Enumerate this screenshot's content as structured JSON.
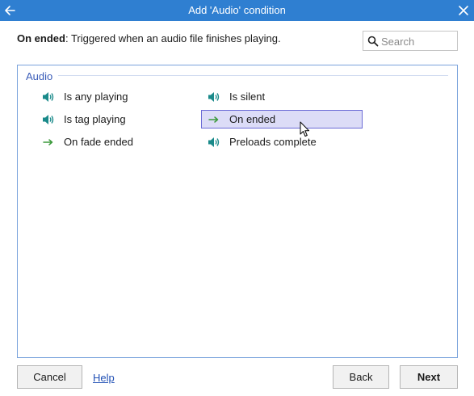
{
  "window": {
    "title": "Add 'Audio' condition"
  },
  "description": {
    "name": "On ended",
    "text": ": Triggered when an audio file finishes playing."
  },
  "search": {
    "placeholder": "Search",
    "value": ""
  },
  "group": {
    "label": "Audio",
    "items": [
      {
        "label": "Is any playing",
        "icon": "speaker-icon"
      },
      {
        "label": "Is silent",
        "icon": "speaker-icon"
      },
      {
        "label": "Is tag playing",
        "icon": "speaker-icon"
      },
      {
        "label": "On ended",
        "icon": "arrow-right-icon",
        "selected": true
      },
      {
        "label": "On fade ended",
        "icon": "arrow-right-icon"
      },
      {
        "label": "Preloads complete",
        "icon": "speaker-icon"
      }
    ]
  },
  "footer": {
    "cancel_label": "Cancel",
    "help_label": "Help",
    "back_label": "Back",
    "next_label": "Next"
  },
  "colors": {
    "titlebar": "#2f7fd1",
    "speaker_icon": "#1a8a8a",
    "arrow_icon": "#3c9a3c",
    "selected_bg": "#dcdcf7",
    "selected_border": "#6b6bd6",
    "link": "#2251b5"
  }
}
